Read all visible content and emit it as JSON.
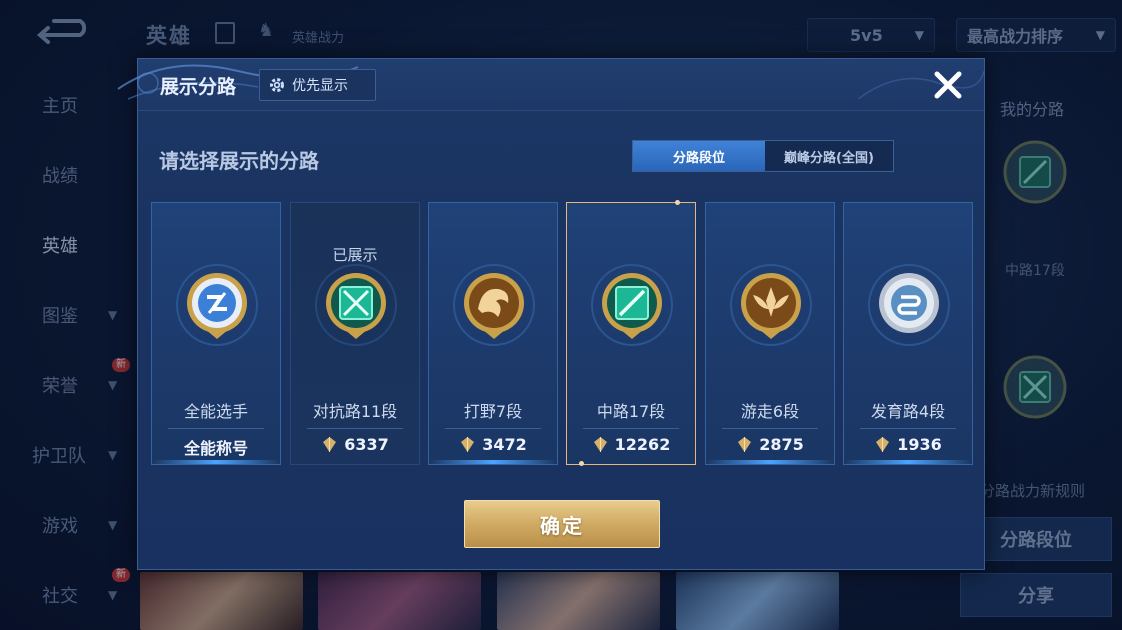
{
  "background": {
    "title": "英雄",
    "power_label": "英雄战力",
    "mode_dropdown": "5v5",
    "sort_dropdown": "最高战力排序",
    "sidebar": [
      {
        "label": "主页",
        "chevron": false,
        "new": false
      },
      {
        "label": "战绩",
        "chevron": false,
        "new": false
      },
      {
        "label": "英雄",
        "chevron": false,
        "new": false,
        "active": true
      },
      {
        "label": "图鉴",
        "chevron": true,
        "new": false
      },
      {
        "label": "荣誉",
        "chevron": true,
        "new": true
      },
      {
        "label": "护卫队",
        "chevron": true,
        "new": false
      },
      {
        "label": "游戏",
        "chevron": true,
        "new": false
      },
      {
        "label": "社交",
        "chevron": true,
        "new": true
      }
    ],
    "new_badge": "新",
    "right_panel": {
      "title": "我的分路",
      "lane_label": "中路17段",
      "rule_link": "分路战力新规则",
      "lane_rank_button": "分路段位",
      "share_button": "分享"
    }
  },
  "modal": {
    "title": "展示分路",
    "priority_button": "优先显示",
    "subtitle": "请选择展示的分路",
    "tabs": [
      {
        "label": "分路段位",
        "active": true
      },
      {
        "label": "巅峰分路(全国)",
        "active": false
      }
    ],
    "cards": [
      {
        "lane": "全能选手",
        "score": "全能称号",
        "note": "",
        "emblem": "versatile-emblem",
        "color": "#4a8fe0",
        "show_power_icon": false,
        "state": "normal"
      },
      {
        "lane": "对抗路11段",
        "score": "6337",
        "note": "已展示",
        "emblem": "clash-lane-emblem",
        "color": "#1fbf9c",
        "show_power_icon": true,
        "state": "shown"
      },
      {
        "lane": "打野7段",
        "score": "3472",
        "note": "",
        "emblem": "jungle-emblem",
        "color": "#c98a2e",
        "show_power_icon": true,
        "state": "normal"
      },
      {
        "lane": "中路17段",
        "score": "12262",
        "note": "",
        "emblem": "mid-lane-emblem",
        "color": "#1fbf9c",
        "show_power_icon": true,
        "state": "selected"
      },
      {
        "lane": "游走6段",
        "score": "2875",
        "note": "",
        "emblem": "roam-emblem",
        "color": "#c98a2e",
        "show_power_icon": true,
        "state": "normal"
      },
      {
        "lane": "发育路4段",
        "score": "1936",
        "note": "",
        "emblem": "farm-lane-emblem",
        "color": "#9aa4b4",
        "show_power_icon": true,
        "state": "normal"
      }
    ],
    "confirm_button": "确定"
  }
}
